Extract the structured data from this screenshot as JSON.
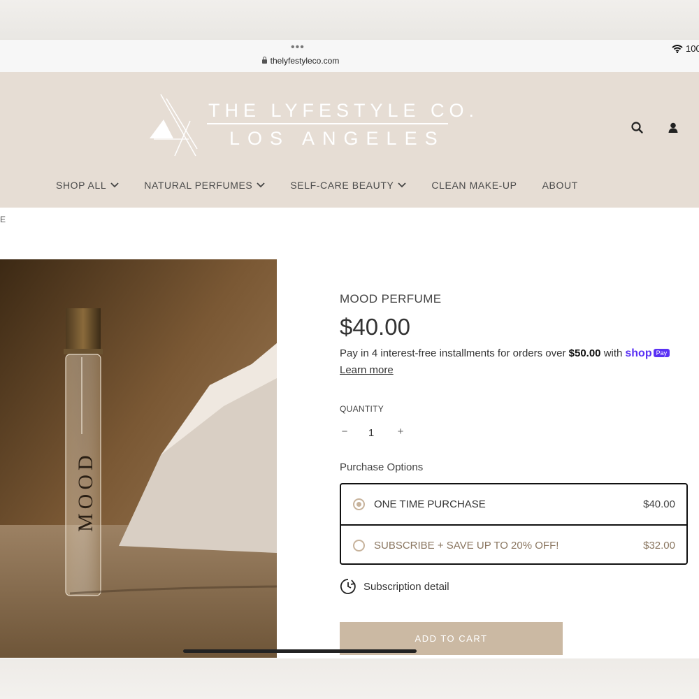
{
  "browser": {
    "url": "thelyfestyleco.com",
    "battery_text": "100"
  },
  "header": {
    "logo_line1": "THE LYFESTYLE CO.",
    "logo_line2": "LOS ANGELES"
  },
  "nav": {
    "items": [
      {
        "label": "SHOP ALL",
        "has_dropdown": true
      },
      {
        "label": "NATURAL PERFUMES",
        "has_dropdown": true
      },
      {
        "label": "SELF-CARE BEAUTY",
        "has_dropdown": true
      },
      {
        "label": "CLEAN MAKE-UP",
        "has_dropdown": false
      },
      {
        "label": "ABOUT",
        "has_dropdown": false
      }
    ]
  },
  "breadcrumb_fragment": "E",
  "product": {
    "bottle_text": "MOOD",
    "title": "MOOD PERFUME",
    "price": "$40.00",
    "installments_text": "Pay in 4 interest-free installments for orders over ",
    "installments_amount": "$50.00",
    "installments_with": " with",
    "shop_word": "shop",
    "pay_badge": "Pay",
    "learn_more": "Learn more",
    "quantity_label": "QUANTITY",
    "quantity_minus": "−",
    "quantity_value": "1",
    "quantity_plus": "+",
    "purchase_options_label": "Purchase Options",
    "options": [
      {
        "label": "ONE TIME PURCHASE",
        "price": "$40.00",
        "selected": true
      },
      {
        "label": "SUBSCRIBE + SAVE UP TO 20% OFF!",
        "price": "$32.00",
        "selected": false
      }
    ],
    "subscription_detail": "Subscription detail",
    "add_to_cart": "ADD TO CART"
  },
  "colors": {
    "header_bg": "#e6ddd4",
    "accent": "#cbb9a3",
    "shop_pay": "#5a31f4"
  },
  "icons": [
    "lock-icon",
    "wifi-icon",
    "search-icon",
    "user-icon",
    "chevron-down-icon",
    "clock-refresh-icon"
  ]
}
